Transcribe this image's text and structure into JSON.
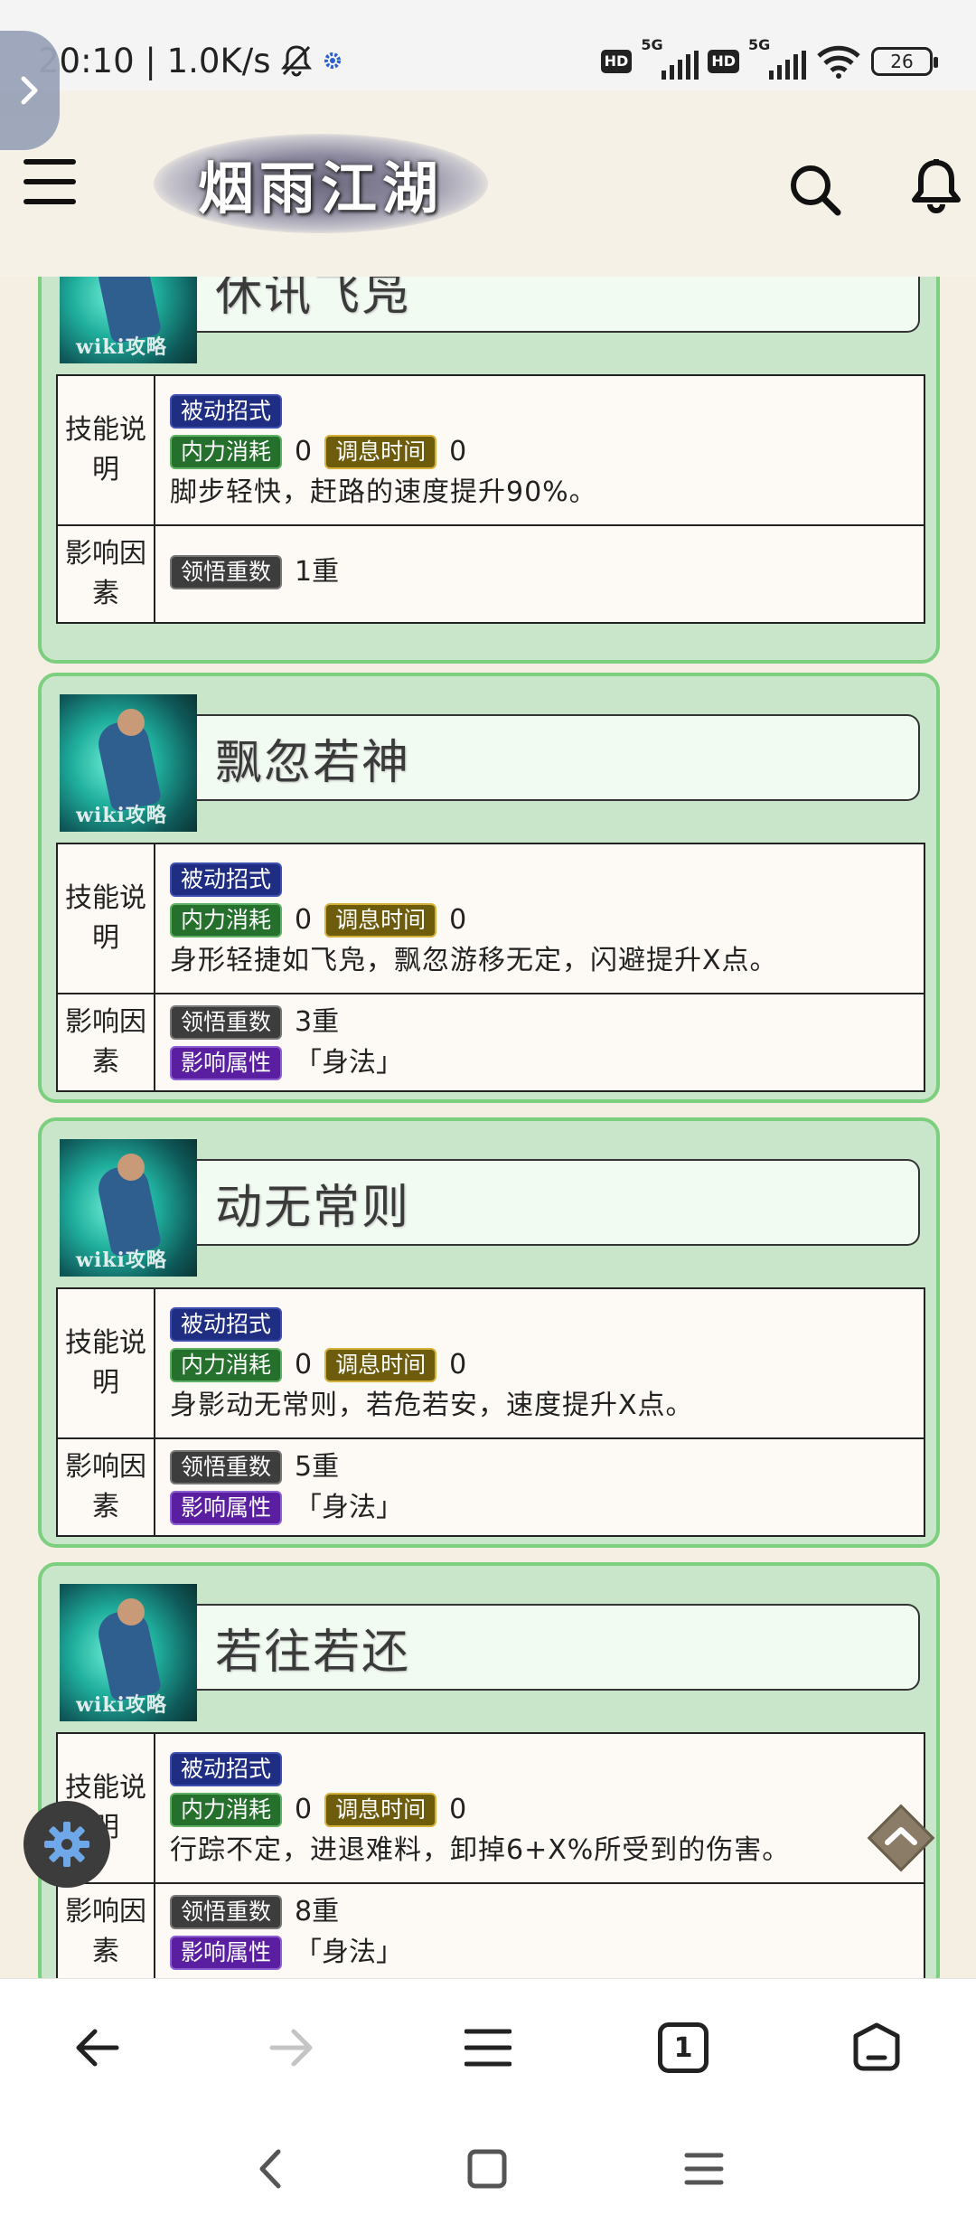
{
  "status_bar": {
    "time_speed": "20:10 | 1.0K/s",
    "hd1": "HD",
    "net1": "5G",
    "hd2": "HD",
    "net2": "5G",
    "battery": "26"
  },
  "header": {
    "logo_text": "烟雨江湖"
  },
  "labels": {
    "desc_label": "技能说明",
    "factor_label": "影响因素",
    "watermark": "wiki攻略"
  },
  "tags": {
    "passive": "被动招式",
    "mp_cost": "内力消耗",
    "cooldown": "调息时间",
    "comprehend": "领悟重数",
    "attribute": "影响属性"
  },
  "skills": [
    {
      "name": "休讯飞凫",
      "mp_cost": "0",
      "cooldown": "0",
      "description": "脚步轻快，赶路的速度提升90%。",
      "comprehend": "1重",
      "attribute": ""
    },
    {
      "name": "飘忽若神",
      "mp_cost": "0",
      "cooldown": "0",
      "description": "身形轻捷如飞凫，飘忽游移无定，闪避提升X点。",
      "comprehend": "3重",
      "attribute": "「身法」"
    },
    {
      "name": "动无常则",
      "mp_cost": "0",
      "cooldown": "0",
      "description": "身影动无常则，若危若安，速度提升X点。",
      "comprehend": "5重",
      "attribute": "「身法」"
    },
    {
      "name": "若往若还",
      "mp_cost": "0",
      "cooldown": "0",
      "description": "行踪不定，进退难料，卸掉6+X%所受到的伤害。",
      "comprehend": "8重",
      "attribute": "「身法」"
    }
  ],
  "browser": {
    "tab_count": "1"
  },
  "colors": {
    "card_bg": "#c9e6cb",
    "card_border": "#7ccf7f",
    "tag_blue": "#1f2e83",
    "tag_green": "#24702c",
    "tag_olive": "#6e5c0d",
    "tag_gray": "#3d3d3d",
    "tag_purple": "#5a1fa0"
  }
}
